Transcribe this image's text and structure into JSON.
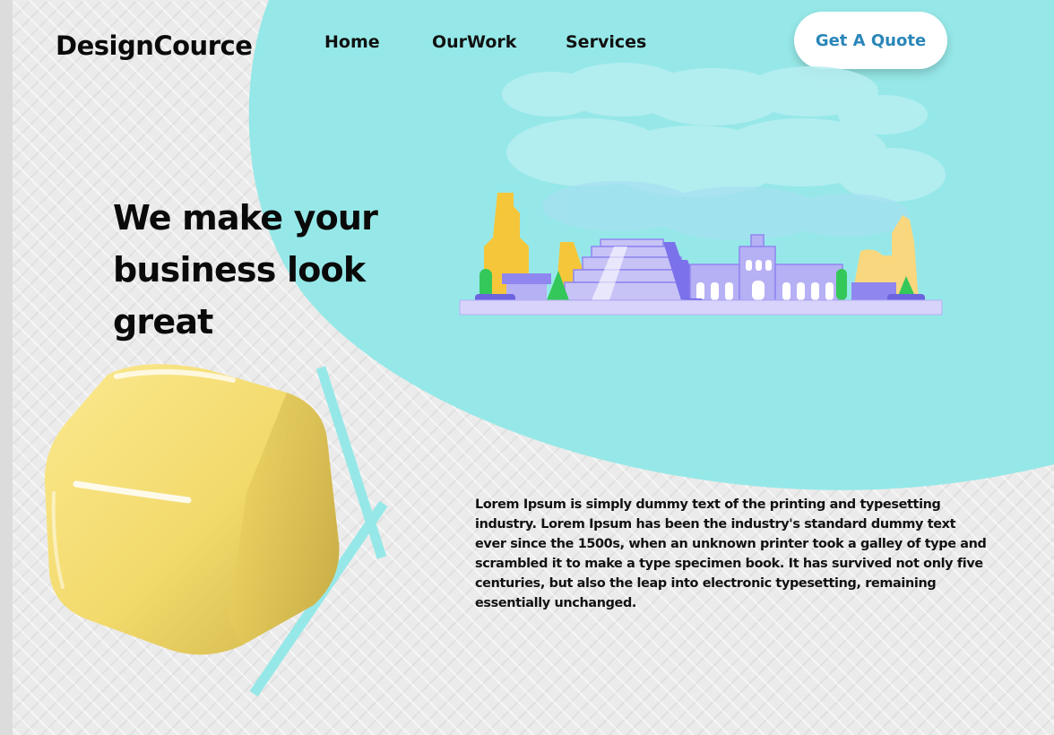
{
  "brand": {
    "name": "DesignCource"
  },
  "nav": {
    "items": [
      {
        "label": "Home"
      },
      {
        "label": "OurWork"
      },
      {
        "label": "Services"
      }
    ],
    "cta_label": "Get A Quote"
  },
  "hero": {
    "headline": "We make your business look great",
    "body": "Lorem Ipsum is simply dummy text of the printing and typesetting industry. Lorem Ipsum has been the industry's standard dummy text ever since the 1500s, when an unknown printer took a galley of type and scrambled it to make a type specimen book. It has survived not only five centuries, but also the leap into electronic typesetting, remaining essentially unchanged."
  },
  "colors": {
    "accent_teal": "#96e8e8",
    "cta_text": "#2a86b8",
    "cube_yellow": "#f2d96a",
    "illustration_purple": "#8f86f0",
    "illustration_yellow": "#f6c63a"
  }
}
